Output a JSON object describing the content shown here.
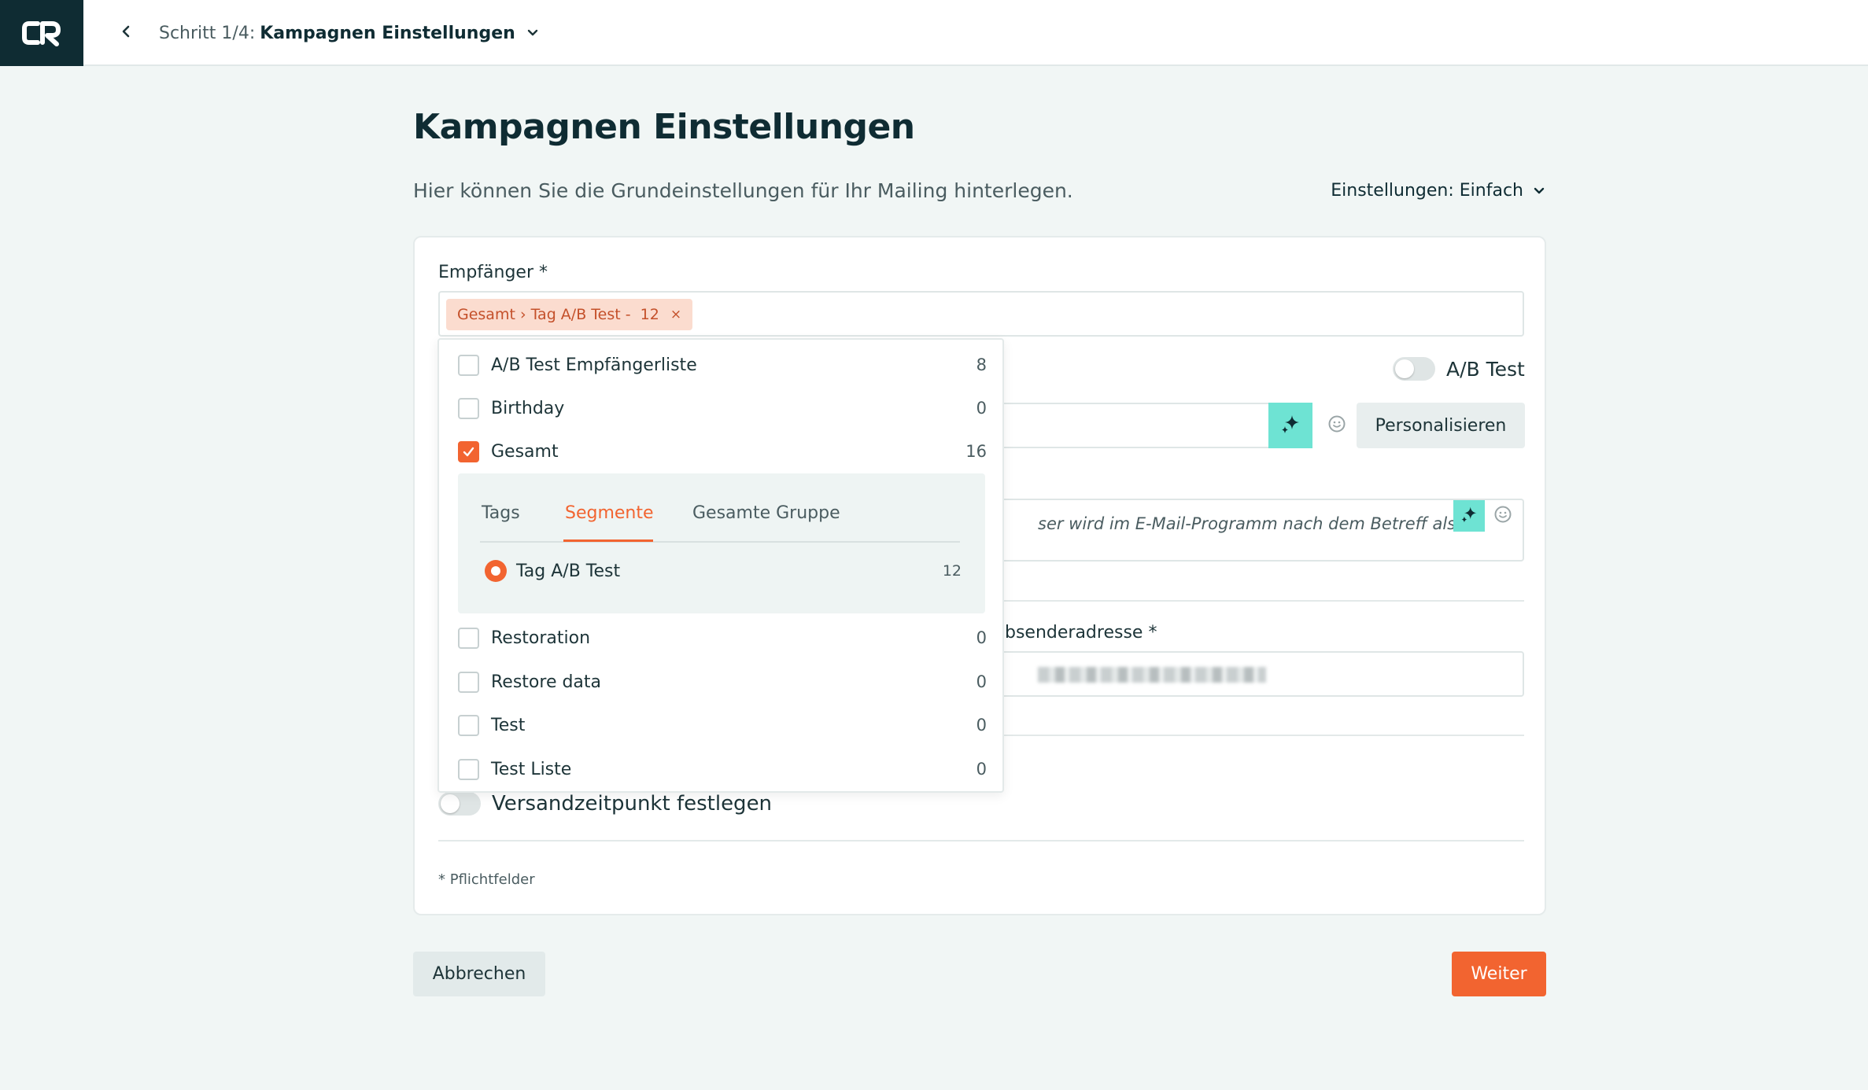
{
  "header": {
    "logo_icon": "cr-logo-icon",
    "back_icon": "chevron-left-icon",
    "step_label": "Schritt 1/4:",
    "title": "Kampagnen Einstellungen",
    "chevron_icon": "chevron-down-icon"
  },
  "page": {
    "title": "Kampagnen Einstellungen",
    "subtitle": "Hier können Sie die Grundeinstellungen für Ihr Mailing hinterlegen.",
    "settings_mode": "Einstellungen: Einfach"
  },
  "form": {
    "recipient_label": "Empfänger *",
    "recipient_chip": "Gesamt › Tag A/B Test -  12",
    "chip_remove": "×",
    "ab_test_label": "A/B Test",
    "ab_test_enabled": false,
    "personalize_label": "Personalisieren",
    "preheader_placeholder": "ser wird im E-Mail-Programm nach dem Betreff als",
    "sender_label": "bsenderadresse *",
    "send_time_label": "Versandzeitpunkt festlegen",
    "send_time_enabled": false,
    "required_note": "* Pflichtfelder"
  },
  "dropdown": {
    "lists_before": [
      {
        "name": "A/B Test Empfängerliste",
        "count": "8",
        "checked": false
      },
      {
        "name": "Birthday",
        "count": "0",
        "checked": false
      },
      {
        "name": "Gesamt",
        "count": "16",
        "checked": true
      }
    ],
    "subpanel": {
      "tabs": [
        "Tags",
        "Segmente",
        "Gesamte Gruppe"
      ],
      "active_tab": "Segmente",
      "segment": {
        "name": "Tag A/B Test",
        "count": "12",
        "selected": true
      }
    },
    "lists_after": [
      {
        "name": "Restoration",
        "count": "0",
        "checked": false
      },
      {
        "name": "Restore data",
        "count": "0",
        "checked": false
      },
      {
        "name": "Test",
        "count": "0",
        "checked": false
      },
      {
        "name": "Test Liste",
        "count": "0",
        "checked": false
      }
    ]
  },
  "footer": {
    "cancel_label": "Abbrechen",
    "next_label": "Weiter"
  },
  "colors": {
    "accent": "#f26430",
    "dark": "#0f2c33",
    "ai_teal": "#6ee3d3",
    "chip_bg": "#fbdccf"
  }
}
